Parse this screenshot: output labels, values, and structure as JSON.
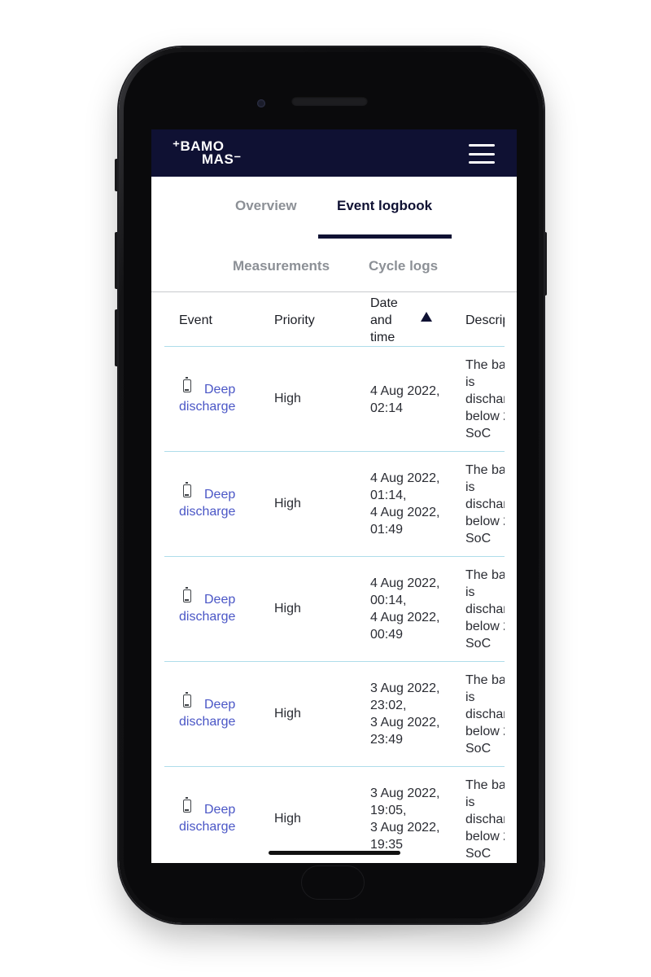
{
  "brand": {
    "line1": "⁺BAMO",
    "line2": "MAS⁻"
  },
  "header": {
    "menu_icon": "hamburger-menu-icon"
  },
  "tabs": [
    {
      "label": "Overview",
      "active": false
    },
    {
      "label": "Event logbook",
      "active": true
    },
    {
      "label": "Measurements",
      "active": false
    },
    {
      "label": "Cycle logs",
      "active": false
    }
  ],
  "table": {
    "columns": [
      "Event",
      "Priority",
      "Date and time",
      "Descrip"
    ],
    "sort": {
      "column": "Date and time",
      "direction": "ascending"
    },
    "rows": [
      {
        "icon": "battery-icon",
        "event_w1": "Deep",
        "event_w2": "discharge",
        "priority": "High",
        "date": [
          "4 Aug 2022,",
          "02:14"
        ],
        "desc": [
          "The ba",
          "is",
          "dischar",
          "below 2",
          "SoC"
        ]
      },
      {
        "icon": "battery-icon",
        "event_w1": "Deep",
        "event_w2": "discharge",
        "priority": "High",
        "date": [
          "4 Aug 2022,",
          "01:14,",
          "4 Aug 2022,",
          "01:49"
        ],
        "desc": [
          "The ba",
          "is",
          "dischar",
          "below 2",
          "SoC"
        ]
      },
      {
        "icon": "battery-icon",
        "event_w1": "Deep",
        "event_w2": "discharge",
        "priority": "High",
        "date": [
          "4 Aug 2022,",
          "00:14,",
          "4 Aug 2022,",
          "00:49"
        ],
        "desc": [
          "The ba",
          "is",
          "dischar",
          "below 2",
          "SoC"
        ]
      },
      {
        "icon": "battery-icon",
        "event_w1": "Deep",
        "event_w2": "discharge",
        "priority": "High",
        "date": [
          "3 Aug 2022,",
          "23:02,",
          "3 Aug 2022,",
          "23:49"
        ],
        "desc": [
          "The ba",
          "is",
          "dischar",
          "below 2",
          "SoC"
        ]
      },
      {
        "icon": "battery-icon",
        "event_w1": "Deep",
        "event_w2": "discharge",
        "priority": "High",
        "date": [
          "3 Aug 2022,",
          "19:05,",
          "3 Aug 2022,",
          "19:35"
        ],
        "desc": [
          "The ba",
          "is",
          "dischar",
          "below 2",
          "SoC"
        ]
      }
    ]
  },
  "colors": {
    "navy": "#0f1133",
    "link": "#4a56c6",
    "divider": "#aeddea",
    "muted_tab": "#8c9096"
  }
}
